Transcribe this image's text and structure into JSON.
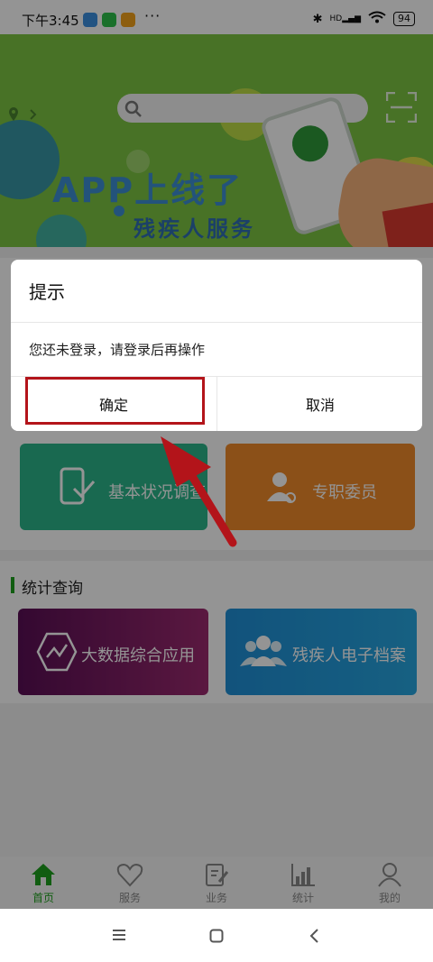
{
  "status_bar": {
    "time": "下午3:45",
    "more": "···",
    "network": "HD",
    "battery": "94"
  },
  "banner": {
    "title": "APP上线了",
    "subtitle": "残疾人服务"
  },
  "sections": [
    {
      "title": "统计查询",
      "cards": [
        {
          "label": "大数据综合应用",
          "icon": "hexagon-chart-icon"
        },
        {
          "label": "残疾人电子档案",
          "icon": "people-icon"
        }
      ]
    }
  ],
  "cards_row1": [
    {
      "label": "基本状况调查",
      "icon": "phone-check-icon"
    },
    {
      "label": "专职委员",
      "icon": "support-person-icon"
    }
  ],
  "dialog": {
    "title": "提示",
    "message": "您还未登录，请登录后再操作",
    "confirm_label": "确定",
    "cancel_label": "取消"
  },
  "tab_bar": {
    "items": [
      {
        "label": "首页",
        "icon": "home-icon",
        "active": true
      },
      {
        "label": "服务",
        "icon": "heart-icon",
        "active": false
      },
      {
        "label": "业务",
        "icon": "clipboard-edit-icon",
        "active": false
      },
      {
        "label": "统计",
        "icon": "bar-chart-icon",
        "active": false
      },
      {
        "label": "我的",
        "icon": "user-icon",
        "active": false
      }
    ]
  },
  "nav_bar": {
    "icons": [
      "menu-icon",
      "home-square-icon",
      "back-icon"
    ]
  },
  "colors": {
    "accent": "#1ea01e",
    "banner_bg": "#7cc443",
    "card_green": "#2bb58a",
    "card_orange": "#f08a2a",
    "card_purple": "#7a1b63",
    "card_blue": "#1f8fd6",
    "highlight": "#b3141a"
  }
}
